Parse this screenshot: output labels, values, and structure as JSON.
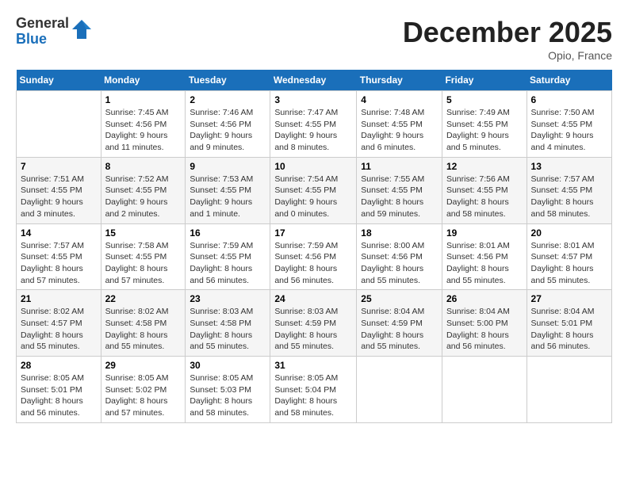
{
  "header": {
    "logo_general": "General",
    "logo_blue": "Blue",
    "month_title": "December 2025",
    "location": "Opio, France"
  },
  "days_of_week": [
    "Sunday",
    "Monday",
    "Tuesday",
    "Wednesday",
    "Thursday",
    "Friday",
    "Saturday"
  ],
  "weeks": [
    [
      {
        "day": "",
        "info": ""
      },
      {
        "day": "1",
        "info": "Sunrise: 7:45 AM\nSunset: 4:56 PM\nDaylight: 9 hours\nand 11 minutes."
      },
      {
        "day": "2",
        "info": "Sunrise: 7:46 AM\nSunset: 4:56 PM\nDaylight: 9 hours\nand 9 minutes."
      },
      {
        "day": "3",
        "info": "Sunrise: 7:47 AM\nSunset: 4:55 PM\nDaylight: 9 hours\nand 8 minutes."
      },
      {
        "day": "4",
        "info": "Sunrise: 7:48 AM\nSunset: 4:55 PM\nDaylight: 9 hours\nand 6 minutes."
      },
      {
        "day": "5",
        "info": "Sunrise: 7:49 AM\nSunset: 4:55 PM\nDaylight: 9 hours\nand 5 minutes."
      },
      {
        "day": "6",
        "info": "Sunrise: 7:50 AM\nSunset: 4:55 PM\nDaylight: 9 hours\nand 4 minutes."
      }
    ],
    [
      {
        "day": "7",
        "info": "Sunrise: 7:51 AM\nSunset: 4:55 PM\nDaylight: 9 hours\nand 3 minutes."
      },
      {
        "day": "8",
        "info": "Sunrise: 7:52 AM\nSunset: 4:55 PM\nDaylight: 9 hours\nand 2 minutes."
      },
      {
        "day": "9",
        "info": "Sunrise: 7:53 AM\nSunset: 4:55 PM\nDaylight: 9 hours\nand 1 minute."
      },
      {
        "day": "10",
        "info": "Sunrise: 7:54 AM\nSunset: 4:55 PM\nDaylight: 9 hours\nand 0 minutes."
      },
      {
        "day": "11",
        "info": "Sunrise: 7:55 AM\nSunset: 4:55 PM\nDaylight: 8 hours\nand 59 minutes."
      },
      {
        "day": "12",
        "info": "Sunrise: 7:56 AM\nSunset: 4:55 PM\nDaylight: 8 hours\nand 58 minutes."
      },
      {
        "day": "13",
        "info": "Sunrise: 7:57 AM\nSunset: 4:55 PM\nDaylight: 8 hours\nand 58 minutes."
      }
    ],
    [
      {
        "day": "14",
        "info": "Sunrise: 7:57 AM\nSunset: 4:55 PM\nDaylight: 8 hours\nand 57 minutes."
      },
      {
        "day": "15",
        "info": "Sunrise: 7:58 AM\nSunset: 4:55 PM\nDaylight: 8 hours\nand 57 minutes."
      },
      {
        "day": "16",
        "info": "Sunrise: 7:59 AM\nSunset: 4:55 PM\nDaylight: 8 hours\nand 56 minutes."
      },
      {
        "day": "17",
        "info": "Sunrise: 7:59 AM\nSunset: 4:56 PM\nDaylight: 8 hours\nand 56 minutes."
      },
      {
        "day": "18",
        "info": "Sunrise: 8:00 AM\nSunset: 4:56 PM\nDaylight: 8 hours\nand 55 minutes."
      },
      {
        "day": "19",
        "info": "Sunrise: 8:01 AM\nSunset: 4:56 PM\nDaylight: 8 hours\nand 55 minutes."
      },
      {
        "day": "20",
        "info": "Sunrise: 8:01 AM\nSunset: 4:57 PM\nDaylight: 8 hours\nand 55 minutes."
      }
    ],
    [
      {
        "day": "21",
        "info": "Sunrise: 8:02 AM\nSunset: 4:57 PM\nDaylight: 8 hours\nand 55 minutes."
      },
      {
        "day": "22",
        "info": "Sunrise: 8:02 AM\nSunset: 4:58 PM\nDaylight: 8 hours\nand 55 minutes."
      },
      {
        "day": "23",
        "info": "Sunrise: 8:03 AM\nSunset: 4:58 PM\nDaylight: 8 hours\nand 55 minutes."
      },
      {
        "day": "24",
        "info": "Sunrise: 8:03 AM\nSunset: 4:59 PM\nDaylight: 8 hours\nand 55 minutes."
      },
      {
        "day": "25",
        "info": "Sunrise: 8:04 AM\nSunset: 4:59 PM\nDaylight: 8 hours\nand 55 minutes."
      },
      {
        "day": "26",
        "info": "Sunrise: 8:04 AM\nSunset: 5:00 PM\nDaylight: 8 hours\nand 56 minutes."
      },
      {
        "day": "27",
        "info": "Sunrise: 8:04 AM\nSunset: 5:01 PM\nDaylight: 8 hours\nand 56 minutes."
      }
    ],
    [
      {
        "day": "28",
        "info": "Sunrise: 8:05 AM\nSunset: 5:01 PM\nDaylight: 8 hours\nand 56 minutes."
      },
      {
        "day": "29",
        "info": "Sunrise: 8:05 AM\nSunset: 5:02 PM\nDaylight: 8 hours\nand 57 minutes."
      },
      {
        "day": "30",
        "info": "Sunrise: 8:05 AM\nSunset: 5:03 PM\nDaylight: 8 hours\nand 58 minutes."
      },
      {
        "day": "31",
        "info": "Sunrise: 8:05 AM\nSunset: 5:04 PM\nDaylight: 8 hours\nand 58 minutes."
      },
      {
        "day": "",
        "info": ""
      },
      {
        "day": "",
        "info": ""
      },
      {
        "day": "",
        "info": ""
      }
    ]
  ]
}
